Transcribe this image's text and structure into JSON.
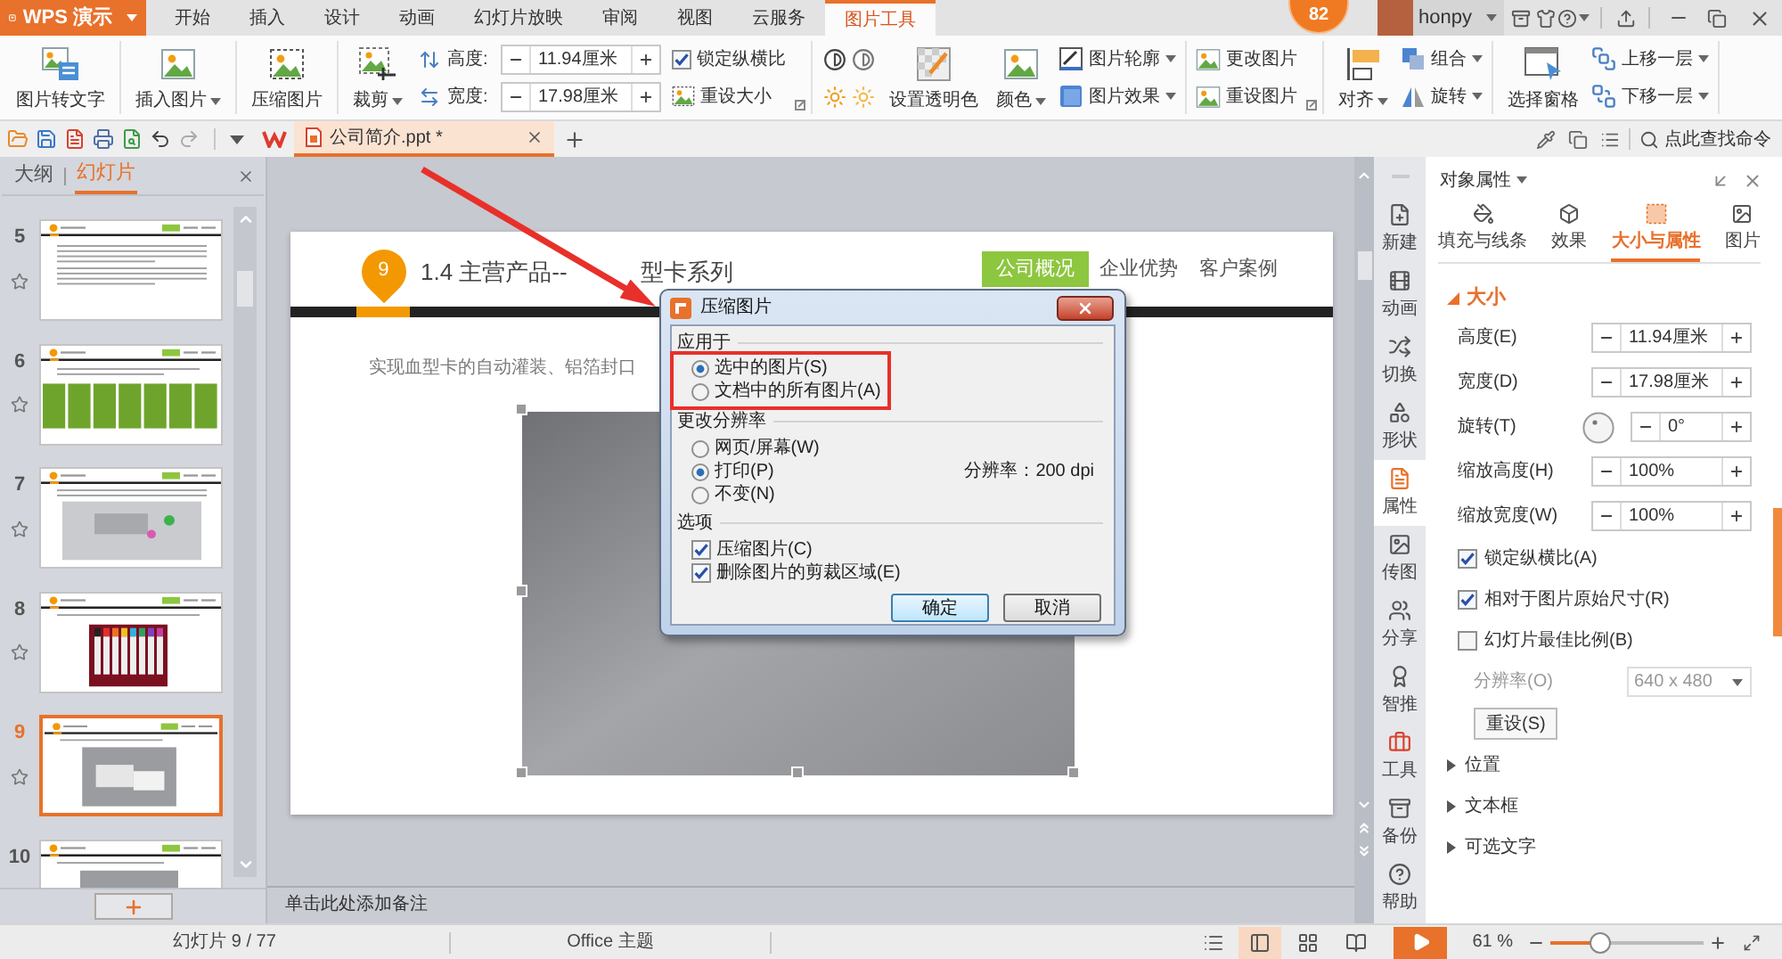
{
  "app_menu": {
    "label": "WPS 演示"
  },
  "ribbon_tabs": [
    {
      "label": "开始",
      "selected": false
    },
    {
      "label": "插入",
      "selected": false
    },
    {
      "label": "设计",
      "selected": false
    },
    {
      "label": "动画",
      "selected": false
    },
    {
      "label": "幻灯片放映",
      "selected": false
    },
    {
      "label": "审阅",
      "selected": false
    },
    {
      "label": "视图",
      "selected": false
    },
    {
      "label": "云服务",
      "selected": false
    },
    {
      "label": "图片工具",
      "selected": true
    }
  ],
  "account": {
    "badge": "82",
    "user": "honpy"
  },
  "ribbon": {
    "picture_to_text": "图片转文字",
    "insert_picture": "插入图片",
    "compress_picture": "压缩图片",
    "crop": "裁剪",
    "height": {
      "label": "高度:",
      "value": "11.94厘米"
    },
    "width": {
      "label": "宽度:",
      "value": "17.98厘米"
    },
    "lock_aspect_ratio": {
      "label": "锁定纵横比",
      "checked": true
    },
    "reset_size": "重设大小",
    "set_transparent_color": "设置透明色",
    "recolor": "颜色",
    "picture_outline": "图片轮廓",
    "picture_effects": "图片效果",
    "change_picture": "更改图片",
    "reset_picture": "重设图片",
    "align": "对齐",
    "group": "组合",
    "rotate": "旋转",
    "selection_pane": "选择窗格",
    "bring_forward": "上移一层",
    "send_backward": "下移一层"
  },
  "quick_access": {
    "document_tab": {
      "title": "公司简介.ppt *"
    },
    "search": {
      "placeholder": "点此查找命令"
    }
  },
  "slides_panel": {
    "tabs": [
      {
        "label": "大纲",
        "selected": false
      },
      {
        "label": "幻灯片",
        "selected": true
      }
    ],
    "thumbnails": [
      {
        "number": "5",
        "kind": "text",
        "selected": false
      },
      {
        "number": "6",
        "kind": "columns",
        "selected": false
      },
      {
        "number": "7",
        "kind": "wide_photo",
        "selected": false
      },
      {
        "number": "8",
        "kind": "tubes",
        "selected": false
      },
      {
        "number": "9",
        "kind": "photo",
        "selected": true
      },
      {
        "number": "10",
        "kind": "photo",
        "selected": false
      }
    ]
  },
  "slide": {
    "marker": "9",
    "title_parts": [
      "1.4 主营产品--",
      "型卡系列"
    ],
    "nav": [
      {
        "label": "公司概况",
        "selected": true
      },
      {
        "label": "企业优势",
        "selected": false
      },
      {
        "label": "客户案例",
        "selected": false
      }
    ],
    "body_text": "实现血型卡的自动灌装、铝箔封口"
  },
  "notes": {
    "placeholder": "单击此处添加备注"
  },
  "dialog": {
    "title": "压缩图片",
    "apply_to": {
      "label": "应用于",
      "options": [
        {
          "label": "选中的图片(S)",
          "selected": true
        },
        {
          "label": "文档中的所有图片(A)",
          "selected": false
        }
      ]
    },
    "resolution": {
      "label": "更改分辨率",
      "options": [
        {
          "label": "网页/屏幕(W)",
          "selected": false
        },
        {
          "label": "打印(P)",
          "selected": true
        },
        {
          "label": "不变(N)",
          "selected": false
        }
      ],
      "reading": "分辨率：200 dpi"
    },
    "options": {
      "label": "选项",
      "items": [
        {
          "label": "压缩图片(C)",
          "checked": true
        },
        {
          "label": "删除图片的剪裁区域(E)",
          "checked": true
        }
      ]
    },
    "buttons": [
      {
        "label": "确定",
        "kind": "default"
      },
      {
        "label": "取消",
        "kind": "normal"
      }
    ]
  },
  "side_tabs": [
    {
      "label": "新建",
      "selected": false
    },
    {
      "label": "动画",
      "selected": false
    },
    {
      "label": "切换",
      "selected": false
    },
    {
      "label": "形状",
      "selected": false
    },
    {
      "label": "属性",
      "selected": true
    },
    {
      "label": "传图",
      "selected": false
    },
    {
      "label": "分享",
      "selected": false
    },
    {
      "label": "智推",
      "selected": false
    },
    {
      "label": "工具",
      "selected": false
    },
    {
      "label": "备份",
      "selected": false
    },
    {
      "label": "帮助",
      "selected": false
    }
  ],
  "properties": {
    "title": "对象属性",
    "tabs": [
      {
        "label": "填充与线条",
        "selected": false
      },
      {
        "label": "效果",
        "selected": false
      },
      {
        "label": "大小与属性",
        "selected": true
      },
      {
        "label": "图片",
        "selected": false
      }
    ],
    "size_section": {
      "label": "大小",
      "expanded": true,
      "fields": [
        {
          "label": "高度(E)",
          "value": "11.94厘米",
          "kind": "spin"
        },
        {
          "label": "宽度(D)",
          "value": "17.98厘米",
          "kind": "spin"
        },
        {
          "label": "旋转(T)",
          "value": "0°",
          "kind": "dial"
        },
        {
          "label": "缩放高度(H)",
          "value": "100%",
          "kind": "spin"
        },
        {
          "label": "缩放宽度(W)",
          "value": "100%",
          "kind": "spin"
        }
      ],
      "checks": [
        {
          "label": "锁定纵横比(A)",
          "checked": true
        },
        {
          "label": "相对于图片原始尺寸(R)",
          "checked": true
        },
        {
          "label": "幻灯片最佳比例(B)",
          "checked": false
        }
      ],
      "resolution": {
        "label": "分辨率(O)",
        "value": "640 x 480",
        "disabled": true
      },
      "reset_button": "重设(S)"
    },
    "sections": [
      {
        "label": "位置",
        "expanded": false
      },
      {
        "label": "文本框",
        "expanded": false
      },
      {
        "label": "可选文字",
        "expanded": false
      }
    ]
  },
  "status_bar": {
    "slide_counter": "幻灯片 9 / 77",
    "theme": "Office 主题",
    "views": [
      {
        "selected": true
      },
      {
        "selected": false
      },
      {
        "selected": false
      }
    ],
    "zoom": "61 %",
    "zoom_slider": {
      "level": 0.33
    }
  }
}
